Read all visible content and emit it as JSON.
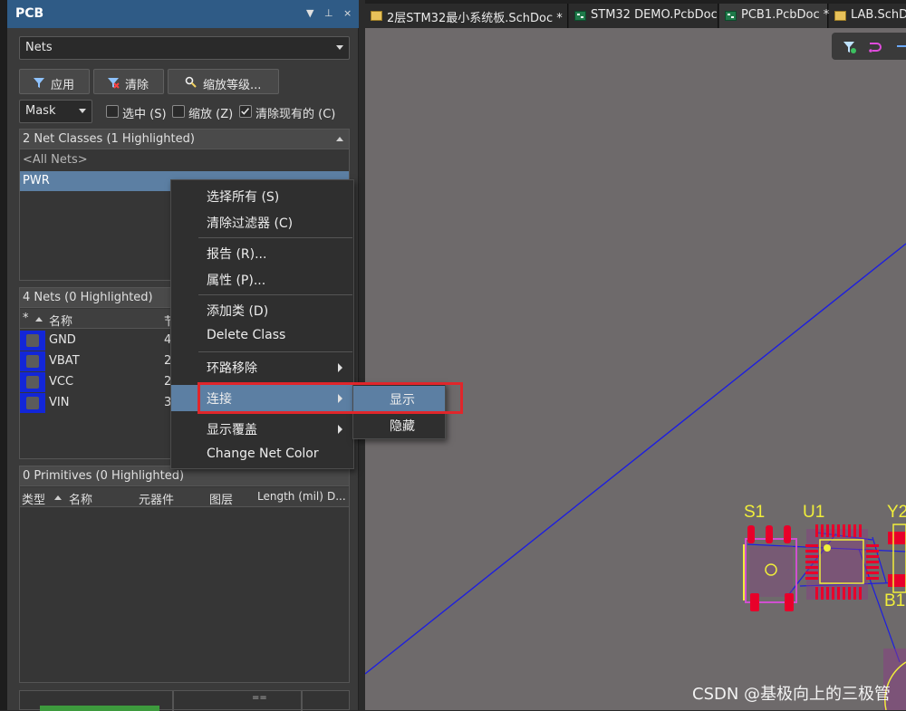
{
  "panel": {
    "title": "PCB",
    "title_controls": [
      "▼",
      "⊥",
      "×"
    ],
    "filter_select": "Nets",
    "buttons": {
      "apply": "应用",
      "clear": "清除",
      "zoom_level": "缩放等级..."
    },
    "mask_select": "Mask",
    "checkboxes": [
      {
        "label": "选中 (S)",
        "checked": false
      },
      {
        "label": "缩放 (Z)",
        "checked": false
      },
      {
        "label": "清除现有的 (C)",
        "checked": true
      }
    ],
    "net_classes": {
      "header": "2 Net Classes (1 Highlighted)",
      "items": [
        "<All Nets>",
        "PWR"
      ]
    },
    "nets": {
      "header": "4 Nets (0 Highlighted)",
      "columns": [
        "*",
        "名称",
        "节"
      ],
      "rows": [
        {
          "name": "GND",
          "nodes": "4"
        },
        {
          "name": "VBAT",
          "nodes": "2"
        },
        {
          "name": "VCC",
          "nodes": "2"
        },
        {
          "name": "VIN",
          "nodes": "3"
        }
      ]
    },
    "primitives": {
      "header": "0 Primitives (0 Highlighted)",
      "columns": [
        "类型",
        "名称",
        "元器件",
        "图层",
        "Length (mil)",
        "D..."
      ]
    },
    "bottom_handle": "=="
  },
  "tabs": [
    {
      "label": "2层STM32最小系统板.SchDoc *",
      "icon": "schematic-doc-icon"
    },
    {
      "label": "STM32 DEMO.PcbDoc",
      "icon": "pcb-doc-icon"
    },
    {
      "label": "PCB1.PcbDoc *",
      "icon": "pcb-doc-icon"
    },
    {
      "label": "LAB.SchDoc",
      "icon": "schematic-doc-icon"
    }
  ],
  "context_menu": {
    "items": [
      {
        "label": "选择所有 (S)"
      },
      {
        "label": "清除过滤器 (C)"
      },
      {
        "label": "报告 (R)..."
      },
      {
        "label": "属性 (P)..."
      },
      {
        "label": "添加类 (D)"
      },
      {
        "label": "Delete Class"
      },
      {
        "label": "环路移除"
      },
      {
        "label": "连接"
      },
      {
        "label": "显示覆盖"
      },
      {
        "label": "Change Net Color"
      }
    ],
    "submenu": [
      "显示",
      "隐藏"
    ]
  },
  "pcb": {
    "designators": [
      "S1",
      "U1",
      "Y2",
      "B1"
    ]
  },
  "colors": {
    "panel_title": "#2f5b86",
    "highlight": "#5c7fa3",
    "net_swatch": "#1226d8",
    "annotation_box": "#e0262b",
    "canvas": "#6e6a6b",
    "pad": "#e8002a",
    "designator": "#f0ee3a",
    "ratsnest": "#1d1ee0"
  },
  "watermark": "CSDN @基极向上的三极管"
}
